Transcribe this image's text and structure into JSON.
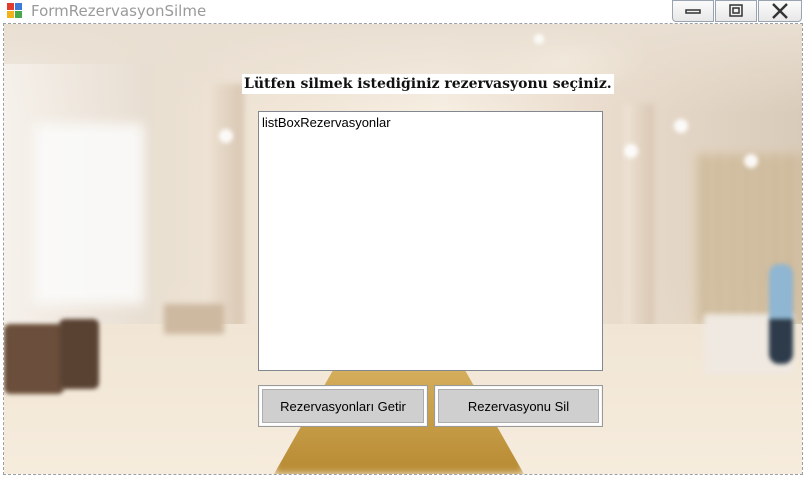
{
  "window": {
    "title": "FormRezervasyonSilme",
    "controls": [
      "minimize-icon",
      "maximize-icon",
      "close-icon"
    ]
  },
  "form": {
    "prompt_label": "Lütfen silmek istediğiniz rezervasyonu seçiniz.",
    "listbox": {
      "items": [
        "listBoxRezervasyonlar"
      ]
    },
    "buttons": {
      "fetch_label": "Rezervasyonları Getir",
      "delete_label": "Rezervasyonu Sil"
    }
  },
  "colors": {
    "button_face": "#cfcfcf",
    "listbox_border": "#828790",
    "title_text": "#9a9a9a"
  }
}
